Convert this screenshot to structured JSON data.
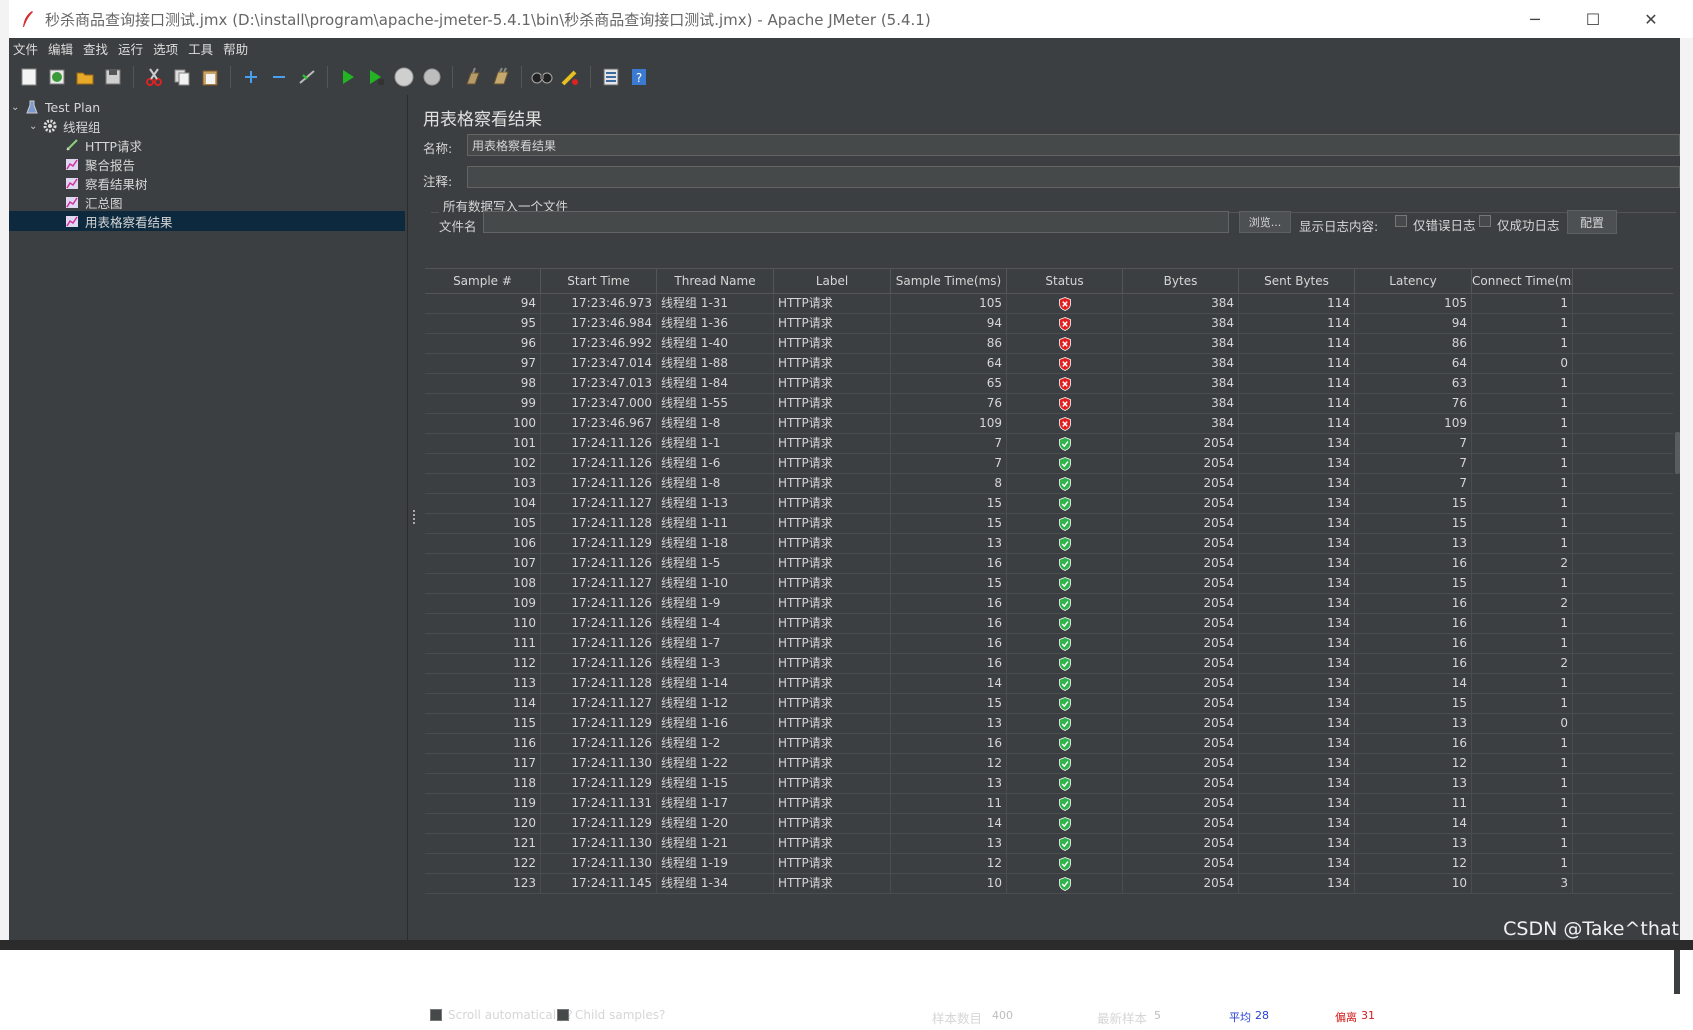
{
  "window": {
    "title": "秒杀商品查询接口测试.jmx (D:\\install\\program\\apache-jmeter-5.4.1\\bin\\秒杀商品查询接口测试.jmx) - Apache JMeter (5.4.1)",
    "minimize": "─",
    "maximize": "☐",
    "close": "✕"
  },
  "menu": [
    "文件",
    "编辑",
    "查找",
    "运行",
    "选项",
    "工具",
    "帮助"
  ],
  "toolbar": {
    "icons": [
      "new-icon",
      "templates-icon",
      "open-icon",
      "save-icon",
      "cut-icon",
      "copy-icon",
      "paste-icon",
      "expand-icon",
      "collapse-icon",
      "toggle-icon",
      "start-icon",
      "start-no-pause-icon",
      "stop-icon",
      "shutdown-icon",
      "clear-icon",
      "clear-all-icon",
      "search-icon",
      "reset-search-icon",
      "function-helper-icon",
      "help-icon"
    ]
  },
  "tree": {
    "items": [
      {
        "label": "Test Plan",
        "icon": "test-plan-icon"
      },
      {
        "label": "线程组",
        "icon": "thread-group-gear-icon"
      },
      {
        "label": "HTTP请求",
        "icon": "http-sampler-icon"
      },
      {
        "label": "聚合报告",
        "icon": "listener-chart-icon"
      },
      {
        "label": "察看结果树",
        "icon": "listener-chart-icon"
      },
      {
        "label": "汇总图",
        "icon": "listener-chart-icon"
      },
      {
        "label": "用表格察看结果",
        "icon": "listener-chart-icon"
      }
    ]
  },
  "panel": {
    "heading": "用表格察看结果",
    "name_label": "名称:",
    "name_value": "用表格察看结果",
    "comment_label": "注释:",
    "comment_value": "",
    "file_group_label": "所有数据写入一个文件",
    "filename_label": "文件名",
    "filename_value": "",
    "browse_label": "浏览...",
    "log_label": "显示日志内容:",
    "errors_only_label": "仅错误日志",
    "success_only_label": "仅成功日志",
    "configure_label": "配置"
  },
  "table": {
    "columns": [
      "Sample #",
      "Start Time",
      "Thread Name",
      "Label",
      "Sample Time(ms)",
      "Status",
      "Bytes",
      "Sent Bytes",
      "Latency",
      "Connect Time(ms)"
    ],
    "rows": [
      [
        "94",
        "17:23:46.973",
        "线程组 1-31",
        "HTTP请求",
        "105",
        "fail",
        "384",
        "114",
        "105",
        "1"
      ],
      [
        "95",
        "17:23:46.984",
        "线程组 1-36",
        "HTTP请求",
        "94",
        "fail",
        "384",
        "114",
        "94",
        "1"
      ],
      [
        "96",
        "17:23:46.992",
        "线程组 1-40",
        "HTTP请求",
        "86",
        "fail",
        "384",
        "114",
        "86",
        "1"
      ],
      [
        "97",
        "17:23:47.014",
        "线程组 1-88",
        "HTTP请求",
        "64",
        "fail",
        "384",
        "114",
        "64",
        "0"
      ],
      [
        "98",
        "17:23:47.013",
        "线程组 1-84",
        "HTTP请求",
        "65",
        "fail",
        "384",
        "114",
        "63",
        "1"
      ],
      [
        "99",
        "17:23:47.000",
        "线程组 1-55",
        "HTTP请求",
        "76",
        "fail",
        "384",
        "114",
        "76",
        "1"
      ],
      [
        "100",
        "17:23:46.967",
        "线程组 1-8",
        "HTTP请求",
        "109",
        "fail",
        "384",
        "114",
        "109",
        "1"
      ],
      [
        "101",
        "17:24:11.126",
        "线程组 1-1",
        "HTTP请求",
        "7",
        "ok",
        "2054",
        "134",
        "7",
        "1"
      ],
      [
        "102",
        "17:24:11.126",
        "线程组 1-6",
        "HTTP请求",
        "7",
        "ok",
        "2054",
        "134",
        "7",
        "1"
      ],
      [
        "103",
        "17:24:11.126",
        "线程组 1-8",
        "HTTP请求",
        "8",
        "ok",
        "2054",
        "134",
        "7",
        "1"
      ],
      [
        "104",
        "17:24:11.127",
        "线程组 1-13",
        "HTTP请求",
        "15",
        "ok",
        "2054",
        "134",
        "15",
        "1"
      ],
      [
        "105",
        "17:24:11.128",
        "线程组 1-11",
        "HTTP请求",
        "15",
        "ok",
        "2054",
        "134",
        "15",
        "1"
      ],
      [
        "106",
        "17:24:11.129",
        "线程组 1-18",
        "HTTP请求",
        "13",
        "ok",
        "2054",
        "134",
        "13",
        "1"
      ],
      [
        "107",
        "17:24:11.126",
        "线程组 1-5",
        "HTTP请求",
        "16",
        "ok",
        "2054",
        "134",
        "16",
        "2"
      ],
      [
        "108",
        "17:24:11.127",
        "线程组 1-10",
        "HTTP请求",
        "15",
        "ok",
        "2054",
        "134",
        "15",
        "1"
      ],
      [
        "109",
        "17:24:11.126",
        "线程组 1-9",
        "HTTP请求",
        "16",
        "ok",
        "2054",
        "134",
        "16",
        "2"
      ],
      [
        "110",
        "17:24:11.126",
        "线程组 1-4",
        "HTTP请求",
        "16",
        "ok",
        "2054",
        "134",
        "16",
        "1"
      ],
      [
        "111",
        "17:24:11.126",
        "线程组 1-7",
        "HTTP请求",
        "16",
        "ok",
        "2054",
        "134",
        "16",
        "1"
      ],
      [
        "112",
        "17:24:11.126",
        "线程组 1-3",
        "HTTP请求",
        "16",
        "ok",
        "2054",
        "134",
        "16",
        "2"
      ],
      [
        "113",
        "17:24:11.128",
        "线程组 1-14",
        "HTTP请求",
        "14",
        "ok",
        "2054",
        "134",
        "14",
        "1"
      ],
      [
        "114",
        "17:24:11.127",
        "线程组 1-12",
        "HTTP请求",
        "15",
        "ok",
        "2054",
        "134",
        "15",
        "1"
      ],
      [
        "115",
        "17:24:11.129",
        "线程组 1-16",
        "HTTP请求",
        "13",
        "ok",
        "2054",
        "134",
        "13",
        "0"
      ],
      [
        "116",
        "17:24:11.126",
        "线程组 1-2",
        "HTTP请求",
        "16",
        "ok",
        "2054",
        "134",
        "16",
        "1"
      ],
      [
        "117",
        "17:24:11.130",
        "线程组 1-22",
        "HTTP请求",
        "12",
        "ok",
        "2054",
        "134",
        "12",
        "1"
      ],
      [
        "118",
        "17:24:11.129",
        "线程组 1-15",
        "HTTP请求",
        "13",
        "ok",
        "2054",
        "134",
        "13",
        "1"
      ],
      [
        "119",
        "17:24:11.131",
        "线程组 1-17",
        "HTTP请求",
        "11",
        "ok",
        "2054",
        "134",
        "11",
        "1"
      ],
      [
        "120",
        "17:24:11.129",
        "线程组 1-20",
        "HTTP请求",
        "14",
        "ok",
        "2054",
        "134",
        "14",
        "1"
      ],
      [
        "121",
        "17:24:11.130",
        "线程组 1-21",
        "HTTP请求",
        "13",
        "ok",
        "2054",
        "134",
        "13",
        "1"
      ],
      [
        "122",
        "17:24:11.130",
        "线程组 1-19",
        "HTTP请求",
        "12",
        "ok",
        "2054",
        "134",
        "12",
        "1"
      ],
      [
        "123",
        "17:24:11.145",
        "线程组 1-34",
        "HTTP请求",
        "10",
        "ok",
        "2054",
        "134",
        "10",
        "3"
      ]
    ]
  },
  "status": {
    "scroll_label": "Scroll automatically?",
    "child_label": "Child samples?",
    "sample_count_label": "样本数目",
    "sample_count": "400",
    "latest_label": "最新样本",
    "latest": "5",
    "avg_label": "平均",
    "avg": "28",
    "dev_label": "偏离",
    "dev": "31"
  },
  "watermark": "CSDN @Take^that",
  "colors": {
    "bg": "#3c3f41",
    "selection": "#0d293e",
    "ok": "#2fb34a",
    "fail": "#e02020",
    "avg": "#2a3fd6",
    "dev": "#d61a1a"
  }
}
